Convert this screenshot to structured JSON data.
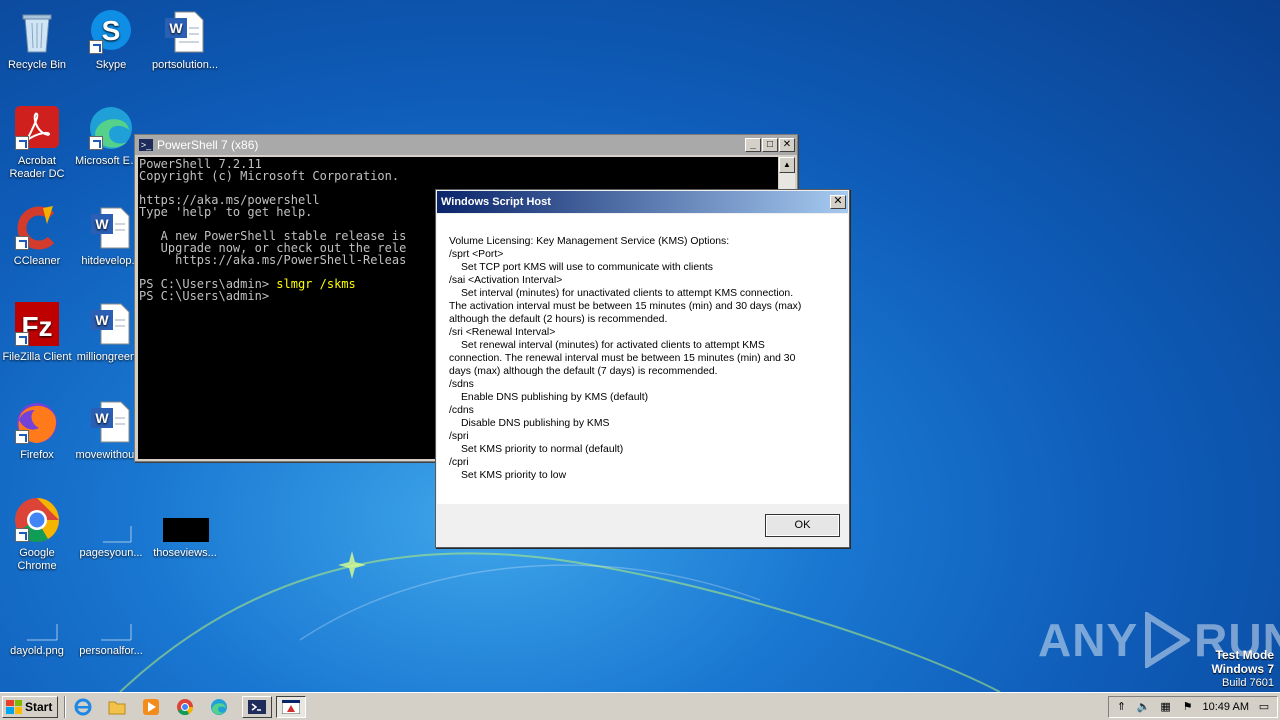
{
  "desktop": {
    "icons": [
      {
        "label": "Recycle Bin"
      },
      {
        "label": "Skype"
      },
      {
        "label": "portsolution..."
      },
      {
        "label": "Acrobat Reader DC"
      },
      {
        "label": "Microsoft Edge"
      },
      {
        "label": "CCleaner"
      },
      {
        "label": "hitdevelop..."
      },
      {
        "label": "FileZilla Client"
      },
      {
        "label": "milliongreen..."
      },
      {
        "label": "Firefox"
      },
      {
        "label": "movewithout..."
      },
      {
        "label": "Google Chrome"
      },
      {
        "label": "pagesyoun..."
      },
      {
        "label": "thoseviews..."
      },
      {
        "label": "dayold.png"
      },
      {
        "label": "personalfor..."
      }
    ]
  },
  "powershell": {
    "title": "PowerShell 7 (x86)",
    "lines": [
      "PowerShell 7.2.11",
      "Copyright (c) Microsoft Corporation.",
      "",
      "https://aka.ms/powershell",
      "Type 'help' to get help.",
      "",
      "   A new PowerShell stable release is",
      "   Upgrade now, or check out the rele",
      "     https://aka.ms/PowerShell-Releas",
      ""
    ],
    "prompt": "PS C:\\Users\\admin> ",
    "command": "slmgr /skms",
    "prompt2": "PS C:\\Users\\admin>"
  },
  "dialog": {
    "title": "Windows Script Host",
    "lines": [
      {
        "text": "Volume Licensing: Key Management Service (KMS) Options:",
        "indent": false
      },
      {
        "text": "/sprt <Port>",
        "indent": false
      },
      {
        "text": "Set TCP port KMS will use to communicate with clients",
        "indent": true
      },
      {
        "text": "/sai <Activation Interval>",
        "indent": false
      },
      {
        "text": "Set interval (minutes) for unactivated clients to attempt KMS connection.",
        "indent": true
      },
      {
        "text": "The activation interval must be between 15 minutes (min) and 30 days (max)",
        "indent": false
      },
      {
        "text": "although the default (2 hours) is recommended.",
        "indent": false
      },
      {
        "text": "/sri <Renewal Interval>",
        "indent": false
      },
      {
        "text": "Set renewal interval (minutes) for activated clients to attempt KMS",
        "indent": true
      },
      {
        "text": "connection. The renewal interval must be between 15 minutes (min) and 30",
        "indent": false
      },
      {
        "text": "days (max) although the default (7 days) is recommended.",
        "indent": false
      },
      {
        "text": "/sdns",
        "indent": false
      },
      {
        "text": "Enable DNS publishing by KMS (default)",
        "indent": true
      },
      {
        "text": "/cdns",
        "indent": false
      },
      {
        "text": "Disable DNS publishing by KMS",
        "indent": true
      },
      {
        "text": "/spri",
        "indent": false
      },
      {
        "text": "Set KMS priority to normal (default)",
        "indent": true
      },
      {
        "text": "/cpri",
        "indent": false
      },
      {
        "text": "Set KMS priority to low",
        "indent": true
      }
    ],
    "ok_label": "OK"
  },
  "watermark": {
    "left": "ANY",
    "right": "RUN"
  },
  "testmode": {
    "line1": "Test Mode",
    "line2": "Windows 7",
    "line3": "Build 7601"
  },
  "taskbar": {
    "start_label": "Start",
    "clock": "10:49 AM"
  },
  "colors": {
    "desktop_blue": "#1a78d2",
    "console_bg": "#000000",
    "console_text": "#c0c0c0",
    "command_highlight": "#ffff00",
    "dialog_title_start": "#0a246a"
  }
}
